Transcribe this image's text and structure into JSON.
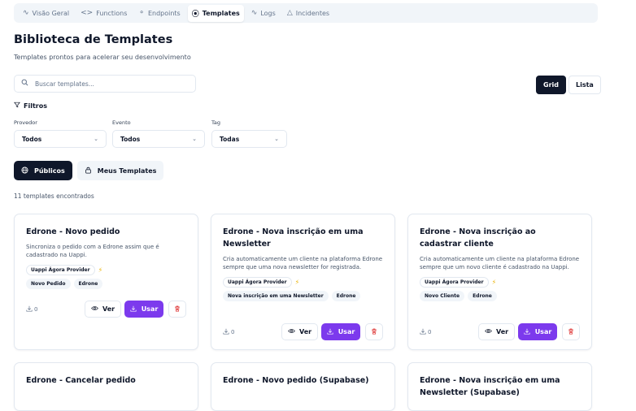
{
  "nav": {
    "tabs": [
      {
        "icon": "activity-icon",
        "glyph": "∿",
        "label": "Visão Geral"
      },
      {
        "icon": "code-icon",
        "glyph": "<>",
        "label": "Functions"
      },
      {
        "icon": "endpoints-icon",
        "glyph": "⚬",
        "label": "Endpoints"
      },
      {
        "icon": "play-circle-icon",
        "glyph": "⦿",
        "label": "Templates"
      },
      {
        "icon": "activity-icon",
        "glyph": "∿",
        "label": "Logs"
      },
      {
        "icon": "alert-triangle-icon",
        "glyph": "△",
        "label": "Incidentes"
      }
    ],
    "active_tab": "Templates"
  },
  "header": {
    "title": "Biblioteca de Templates",
    "subtitle": "Templates prontos para acelerar seu desenvolvimento"
  },
  "search": {
    "placeholder": "Buscar templates..."
  },
  "view": {
    "grid_label": "Grid",
    "list_label": "Lista",
    "active": "Grid"
  },
  "filters": {
    "label": "Filtros",
    "provider": {
      "label": "Provedor",
      "value": "Todos"
    },
    "event": {
      "label": "Evento",
      "value": "Todos"
    },
    "tag": {
      "label": "Tag",
      "value": "Todas"
    }
  },
  "scope": {
    "public_label": "Públicos",
    "mine_label": "Meus Templates",
    "active": "Públicos"
  },
  "results": {
    "count_text": "11 templates encontrados"
  },
  "actions": {
    "view_label": "Ver",
    "use_label": "Usar"
  },
  "templates": [
    {
      "title": "Edrone - Novo pedido",
      "description": "Sincroniza o pedido com a Edrone assim que é cadastrado na Uappi.",
      "provider": "Uappi Ágora Provider",
      "tags": [
        "Novo Pedido",
        "Edrone"
      ],
      "downloads": "0"
    },
    {
      "title": "Edrone - Nova inscrição em uma Newsletter",
      "description": "Cria automaticamente um cliente na plataforma Edrone sempre que uma nova newsletter for registrada.",
      "provider": "Uappi Ágora Provider",
      "tags": [
        "Nova inscrição em uma Newsletter",
        "Edrone"
      ],
      "downloads": "0"
    },
    {
      "title": "Edrone - Nova inscrição ao cadastrar cliente",
      "description": "Cria automaticamente um cliente na plataforma Edrone sempre que um novo cliente é cadastrado na Uappi.",
      "provider": "Uappi Ágora Provider",
      "tags": [
        "Novo Cliente",
        "Edrone"
      ],
      "downloads": "0"
    },
    {
      "title": "Edrone - Cancelar pedido"
    },
    {
      "title": "Edrone - Novo pedido (Supabase)"
    },
    {
      "title": "Edrone - Nova inscrição em uma Newsletter (Supabase)"
    }
  ]
}
